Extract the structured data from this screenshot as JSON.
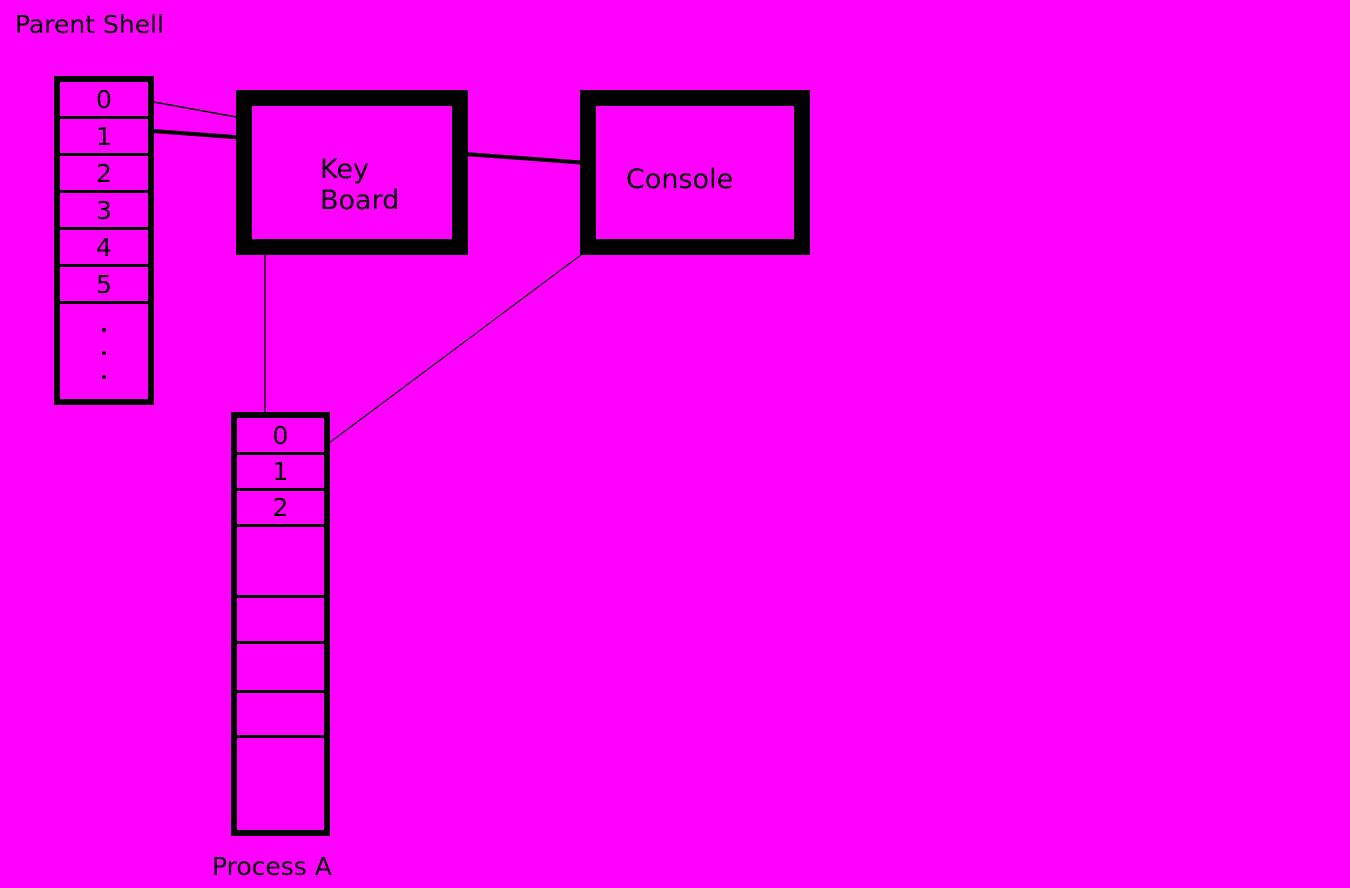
{
  "background_color": "#ff00ff",
  "line_color": "#000000",
  "labels": {
    "parent_shell": "Parent Shell",
    "process_a": "Process A"
  },
  "devices": [
    {
      "name": "keyboard",
      "label": "Key\nBoard"
    },
    {
      "name": "console",
      "label": "Console"
    }
  ],
  "parent_fd_table": {
    "owner": "Parent Shell",
    "rows": [
      "0",
      "1",
      "2",
      "3",
      "4",
      "5",
      "..."
    ],
    "dots_count": 3
  },
  "process_a_fd_table": {
    "owner": "Process A",
    "rows": [
      "0",
      "1",
      "2",
      "",
      "",
      "",
      "",
      ""
    ]
  },
  "connections": [
    {
      "from": "parent_fd_table.row_0",
      "to": "keyboard",
      "style": "thin",
      "arrow": "end"
    },
    {
      "from": "parent_fd_table.row_1",
      "to": "console",
      "style": "thick",
      "arrow": "end"
    },
    {
      "from": "process_a_fd_table.row_0",
      "to": "keyboard",
      "style": "thin",
      "arrow": "end"
    },
    {
      "from": "process_a_fd_table.row_1",
      "to": "console",
      "style": "thin",
      "arrow": "end"
    }
  ]
}
